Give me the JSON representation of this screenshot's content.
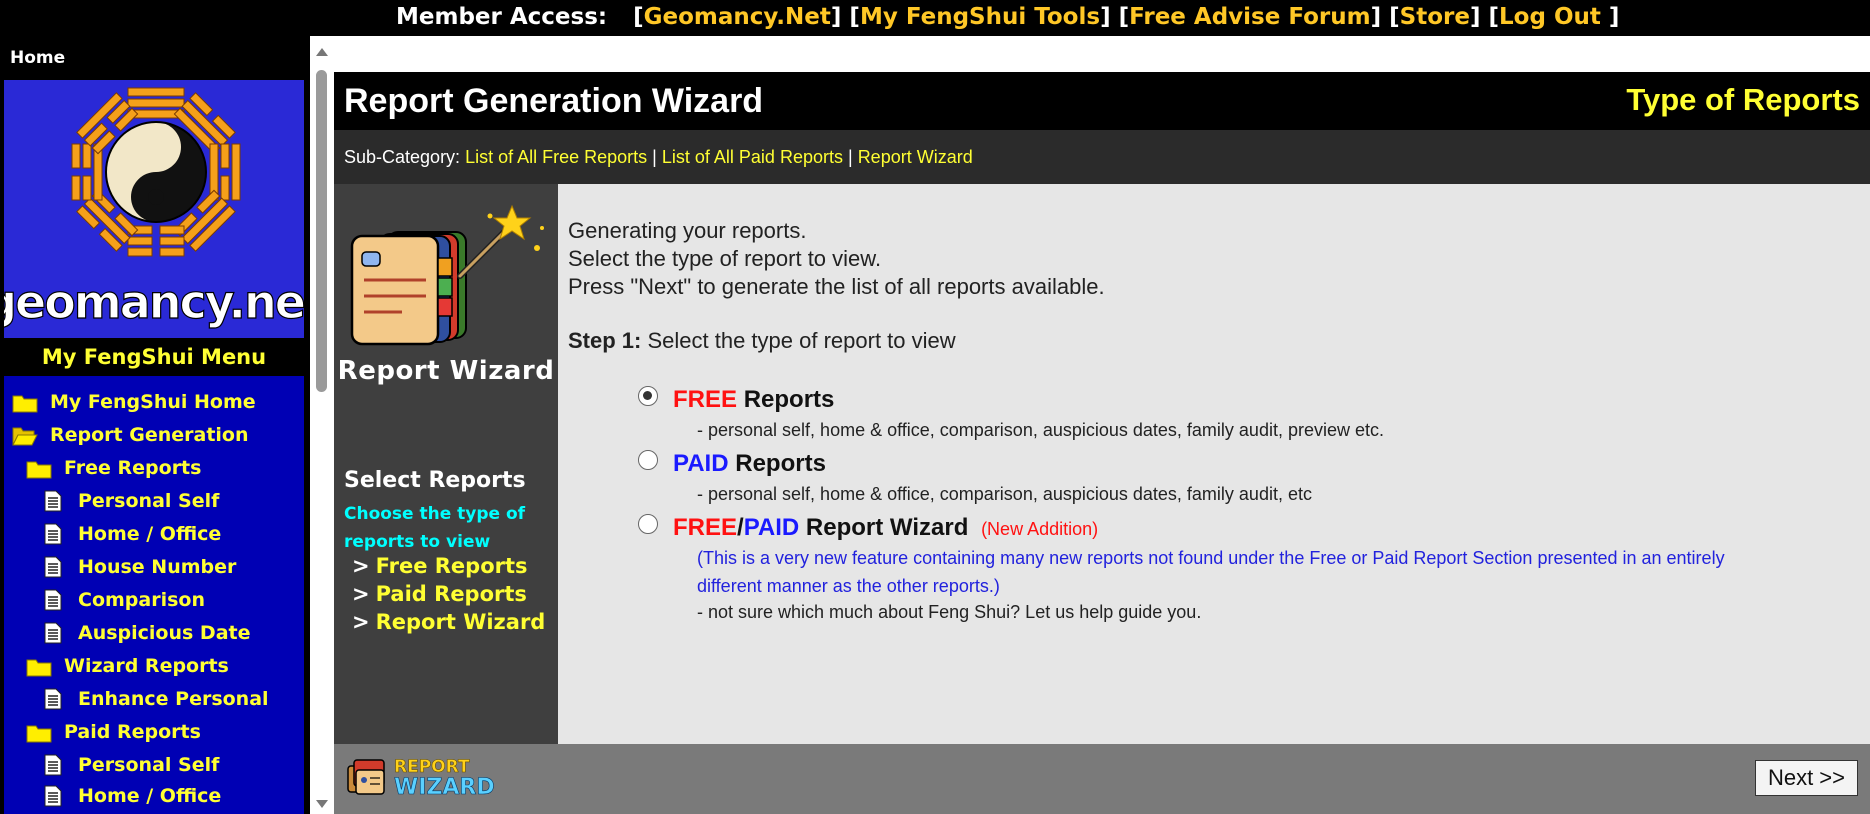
{
  "topbar": {
    "label": "Member Access:",
    "links": [
      "Geomancy.Net",
      "My FengShui Tools",
      "Free Advise Forum",
      "Store",
      "Log Out"
    ]
  },
  "sidebar": {
    "home": "Home",
    "logo_text": "geomancy.net",
    "menu_title": "My FengShui Menu",
    "items": [
      {
        "label": "My FengShui Home",
        "icon": "folder-icon"
      },
      {
        "label": "Report Generation",
        "icon": "folder-open-icon"
      },
      {
        "label": "Free Reports",
        "icon": "folder-icon"
      },
      {
        "label": "Personal Self",
        "icon": "document-icon"
      },
      {
        "label": "Home / Office",
        "icon": "document-icon"
      },
      {
        "label": "House Number",
        "icon": "document-icon"
      },
      {
        "label": "Comparison",
        "icon": "document-icon"
      },
      {
        "label": "Auspicious Date",
        "icon": "document-icon"
      },
      {
        "label": "Wizard Reports",
        "icon": "folder-icon"
      },
      {
        "label": "Enhance Personal",
        "icon": "document-icon"
      },
      {
        "label": "Paid Reports",
        "icon": "folder-icon"
      },
      {
        "label": "Personal Self",
        "icon": "document-icon"
      },
      {
        "label": "Home / Office",
        "icon": "document-icon"
      }
    ]
  },
  "header": {
    "title": "Report Generation Wizard",
    "right_title": "Type of Reports"
  },
  "subcategory": {
    "label": "Sub-Category:",
    "links": [
      "List of All Free Reports",
      "List of All Paid Reports",
      "Report Wizard"
    ],
    "separator": "|"
  },
  "leftpanel": {
    "graphic_label": "Report Wizard",
    "select_title": "Select Reports",
    "select_desc": "Choose the type of reports to view",
    "links": [
      "Free Reports",
      "Paid Reports",
      "Report Wizard"
    ],
    "link_prefix": ">"
  },
  "content": {
    "intro": [
      "Generating your reports.",
      "Select the type of report to view.",
      "Press \"Next\" to generate the list of all reports available."
    ],
    "step_label": "Step 1:",
    "step_text": "Select the type of report to view",
    "options": [
      {
        "checked": true,
        "free": "FREE",
        "reports": "Reports",
        "desc": "- personal self, home & office, comparison, auspicious dates, family audit, preview etc."
      },
      {
        "checked": false,
        "paid": "PAID",
        "reports": "Reports",
        "desc": "- personal self, home & office, comparison, auspicious dates, family audit, etc"
      },
      {
        "checked": false,
        "free": "FREE",
        "slash": "/",
        "paid": "PAID",
        "wizard": "Report Wizard",
        "new_addition": "(New Addition)",
        "note": "(This is a very new feature containing many new reports not found under the Free or Paid Report Section presented in an entirely different manner as the other reports.)",
        "desc": "- not sure which much about Feng Shui? Let us help guide you."
      }
    ]
  },
  "footer": {
    "logo_line1": "REPORT",
    "logo_line2": "WIZARD",
    "next_label": "Next >>"
  },
  "colors": {
    "link_yellow": "#ffff33",
    "topbar_link": "#ffc726",
    "menu_bg": "#0000b4",
    "logo_bg": "#2a29d6",
    "free_red": "#ff1111",
    "paid_blue": "#1a1aff"
  }
}
